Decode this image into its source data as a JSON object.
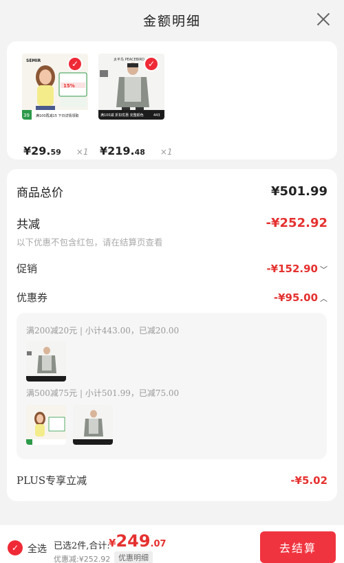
{
  "header": {
    "title": "金额明细"
  },
  "products": [
    {
      "brand": "SEMIR",
      "price_main": "¥29.",
      "price_dec": "59",
      "qty": "×1"
    },
    {
      "brand": "太平鸟 PEACEBIRD",
      "price_main": "¥219.",
      "price_dec": "48",
      "qty": "×1"
    }
  ],
  "summary": {
    "total_label": "商品总价",
    "total_value": "¥501.99",
    "discount_label": "共减",
    "discount_value": "-¥252.92",
    "note": "以下优惠不包含红包，请在结算页查看",
    "promo_label": "促销",
    "promo_value": "-¥152.90",
    "coupon_label": "优惠券",
    "coupon_value": "-¥95.00",
    "coupons": [
      {
        "text": "满200减20元 | 小计443.00，已减20.00"
      },
      {
        "text": "满500减75元 | 小计501.99，已减75.00"
      }
    ],
    "plus_label": "PLUS专享立减",
    "plus_value": "-¥5.02"
  },
  "bottom": {
    "select_all": "全选",
    "selected_text": "已选2件,合计:",
    "currency": "¥",
    "total_int": "249",
    "total_dec": ".07",
    "discount_text": "优惠减:¥252.92",
    "detail_button": "优惠明细",
    "checkout_button": "去结算"
  },
  "colors": {
    "accent": "#e5312f",
    "button": "#f0343f"
  }
}
